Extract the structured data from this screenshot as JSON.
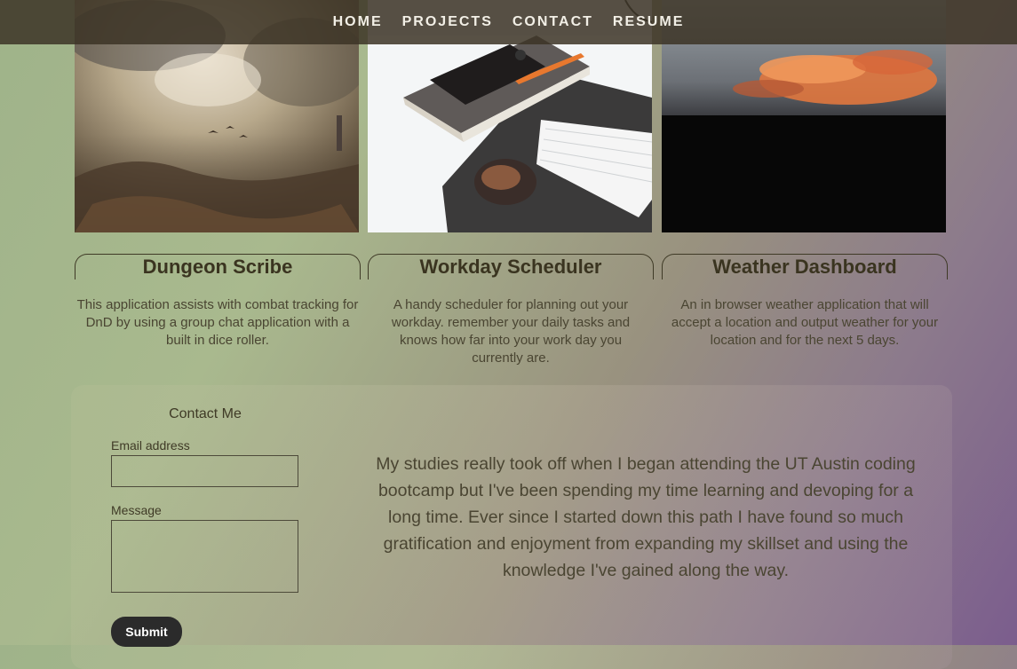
{
  "nav": {
    "items": [
      "HOME",
      "PROJECTS",
      "CONTACT",
      "RESUME"
    ]
  },
  "projects": [
    {
      "title": "Dungeon Scribe",
      "description": "This application assists with combat tracking for DnD by using a group chat application with a built in dice roller.",
      "image": "painting-storm-landscape"
    },
    {
      "title": "Workday Scheduler",
      "description": "A handy scheduler for planning out your workday. remember your daily tasks and knows how far into your work day you currently are.",
      "image": "desk-notebook-phone-keyboard"
    },
    {
      "title": "Weather Dashboard",
      "description": "An in browser weather application that will accept a location and output weather for your location and for the next 5 days.",
      "image": "sunset-clouds"
    }
  ],
  "contact": {
    "heading": "Contact Me",
    "email_label": "Email address",
    "email_value": "",
    "message_label": "Message",
    "message_value": "",
    "submit_label": "Submit"
  },
  "about": {
    "text": "My studies really took off when I began attending the UT Austin coding bootcamp but I've been spending my time learning and devoping for a long time. Ever since I started down this path I have found so much gratification and enjoyment from expanding my skillset and using the knowledge I've gained along the way."
  },
  "colors": {
    "nav_bg": "#3c3426",
    "text_dark": "#3f3a26",
    "submit_bg": "#2b2b2b",
    "gradient_start": "#9fb38a",
    "gradient_end": "#7b5d8d"
  }
}
